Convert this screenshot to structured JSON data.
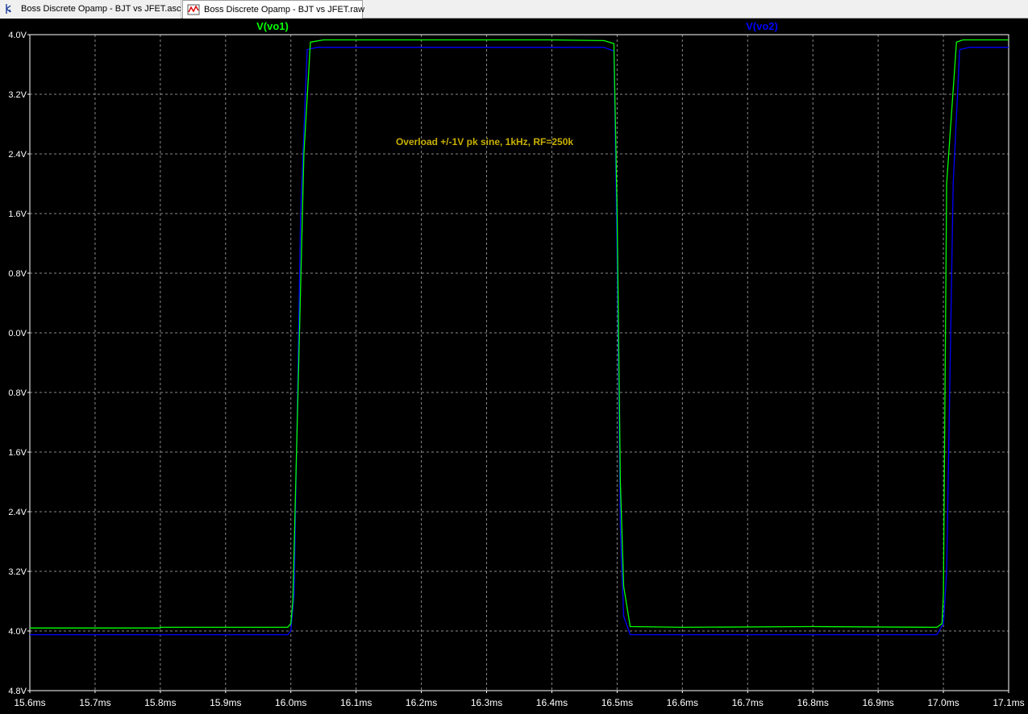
{
  "tabs": [
    {
      "label": "Boss Discrete Opamp - BJT vs JFET.asc",
      "icon": "schematic-icon"
    },
    {
      "label": "Boss Discrete Opamp - BJT vs JFET.raw",
      "icon": "waveform-icon"
    }
  ],
  "chart_data": {
    "type": "line",
    "title": "",
    "annotation": "Overload +/-1V pk sine, 1kHz, RF=250k",
    "xlabel": "",
    "ylabel": "",
    "xlim": [
      15.6,
      17.1
    ],
    "ylim": [
      -4.8,
      4.0
    ],
    "x_unit": "ms",
    "grid": true,
    "x_ticks": [
      "15.6ms",
      "15.7ms",
      "15.8ms",
      "15.9ms",
      "16.0ms",
      "16.1ms",
      "16.2ms",
      "16.3ms",
      "16.4ms",
      "16.5ms",
      "16.6ms",
      "16.7ms",
      "16.8ms",
      "16.9ms",
      "17.0ms",
      "17.1ms"
    ],
    "y_ticks": [
      "4.0V",
      "3.2V",
      "2.4V",
      "1.6V",
      "0.8V",
      "0.0V",
      "0.8V",
      "1.6V",
      "2.4V",
      "3.2V",
      "4.0V",
      "4.8V"
    ],
    "y_tick_values": [
      4.0,
      3.2,
      2.4,
      1.6,
      0.8,
      0.0,
      -0.8,
      -1.6,
      -2.4,
      -3.2,
      -4.0,
      -4.8
    ],
    "series": [
      {
        "name": "V(vo1)",
        "color": "#00ff00",
        "x": [
          15.6,
          15.8,
          15.8,
          15.995,
          16.0,
          16.003,
          16.02,
          16.03,
          16.05,
          16.4,
          16.48,
          16.495,
          16.5,
          16.505,
          16.51,
          16.52,
          16.6,
          16.8,
          16.99,
          16.998,
          17.0,
          17.005,
          17.02,
          17.03,
          17.1
        ],
        "y": [
          -3.96,
          -3.96,
          -3.95,
          -3.95,
          -3.9,
          -3.6,
          2.4,
          3.9,
          3.93,
          3.93,
          3.92,
          3.88,
          1.6,
          -2.0,
          -3.4,
          -3.94,
          -3.95,
          -3.94,
          -3.95,
          -3.9,
          -3.5,
          2.0,
          3.9,
          3.93,
          3.93
        ]
      },
      {
        "name": "V(vo2)",
        "color": "#0000ff",
        "x": [
          15.6,
          15.995,
          16.0,
          16.005,
          16.015,
          16.025,
          16.04,
          16.4,
          16.48,
          16.495,
          16.5,
          16.505,
          16.51,
          16.52,
          16.8,
          16.99,
          17.0,
          17.005,
          17.015,
          17.025,
          17.04,
          17.1
        ],
        "y": [
          -4.05,
          -4.05,
          -4.0,
          -3.5,
          1.6,
          3.8,
          3.83,
          3.83,
          3.83,
          3.78,
          1.0,
          -2.6,
          -3.8,
          -4.05,
          -4.05,
          -4.05,
          -3.9,
          -3.2,
          2.0,
          3.8,
          3.83,
          3.83
        ]
      }
    ]
  }
}
